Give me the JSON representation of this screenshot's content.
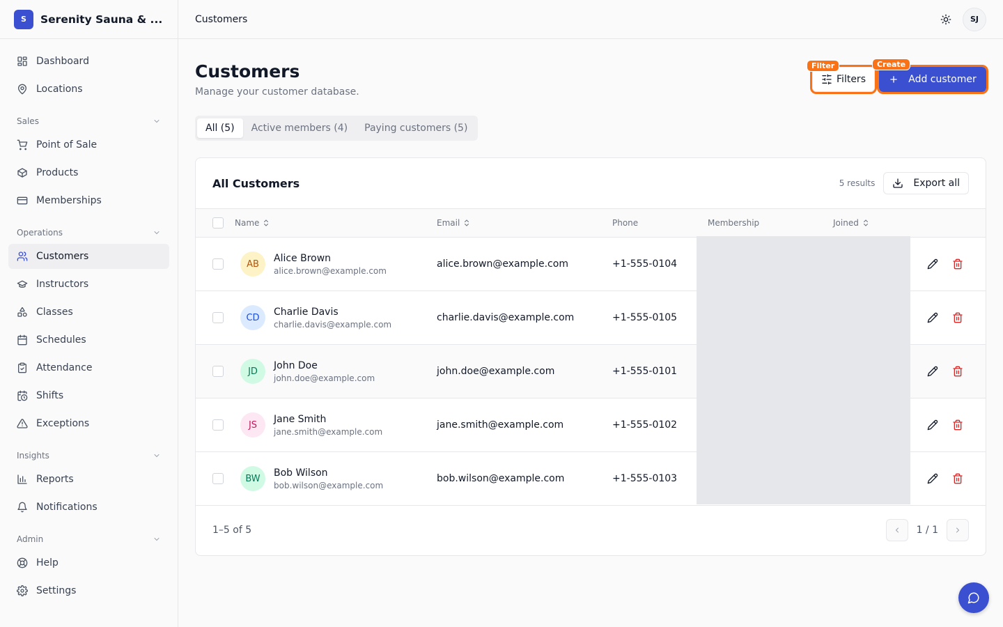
{
  "brand": {
    "initial": "S",
    "name": "Serenity Sauna & ..."
  },
  "sidebar": {
    "top_items": [
      {
        "label": "Dashboard",
        "icon": "dashboard-icon"
      },
      {
        "label": "Locations",
        "icon": "map-pin-icon"
      }
    ],
    "groups": [
      {
        "title": "Sales",
        "items": [
          {
            "label": "Point of Sale",
            "icon": "cart-icon"
          },
          {
            "label": "Products",
            "icon": "package-icon"
          },
          {
            "label": "Memberships",
            "icon": "credit-card-icon"
          }
        ]
      },
      {
        "title": "Operations",
        "items": [
          {
            "label": "Customers",
            "icon": "users-icon",
            "active": true
          },
          {
            "label": "Instructors",
            "icon": "graduation-cap-icon"
          },
          {
            "label": "Classes",
            "icon": "shapes-icon"
          },
          {
            "label": "Schedules",
            "icon": "calendar-icon"
          },
          {
            "label": "Attendance",
            "icon": "clipboard-check-icon"
          },
          {
            "label": "Shifts",
            "icon": "calendar-clock-icon"
          },
          {
            "label": "Exceptions",
            "icon": "alert-triangle-icon"
          }
        ]
      },
      {
        "title": "Insights",
        "items": [
          {
            "label": "Reports",
            "icon": "bar-chart-icon"
          },
          {
            "label": "Notifications",
            "icon": "bell-icon"
          }
        ]
      },
      {
        "title": "Admin",
        "items": [
          {
            "label": "Help",
            "icon": "life-buoy-icon"
          },
          {
            "label": "Settings",
            "icon": "gear-icon"
          }
        ]
      }
    ]
  },
  "topbar": {
    "breadcrumb": "Customers",
    "user_initials": "SJ"
  },
  "page": {
    "title": "Customers",
    "subtitle": "Manage your customer database.",
    "filters_label": "Filters",
    "add_label": "Add customer",
    "tag_filter": "Filter",
    "tag_create": "Create"
  },
  "tabs": [
    {
      "label": "All (5)",
      "active": true
    },
    {
      "label": "Active members (4)"
    },
    {
      "label": "Paying customers (5)"
    }
  ],
  "table": {
    "title": "All Customers",
    "result_count": "5 results",
    "export_label": "Export all",
    "columns": {
      "name": "Name",
      "email": "Email",
      "phone": "Phone",
      "membership": "Membership",
      "joined": "Joined"
    },
    "rows": [
      {
        "initials": "AB",
        "name": "Alice Brown",
        "sub_email": "alice.brown@example.com",
        "email": "alice.brown@example.com",
        "phone": "+1-555-0104",
        "avatar_bg": "#fef3c7",
        "avatar_fg": "#b45309"
      },
      {
        "initials": "CD",
        "name": "Charlie Davis",
        "sub_email": "charlie.davis@example.com",
        "email": "charlie.davis@example.com",
        "phone": "+1-555-0105",
        "avatar_bg": "#dbeafe",
        "avatar_fg": "#1d4ed8"
      },
      {
        "initials": "JD",
        "name": "John Doe",
        "sub_email": "john.doe@example.com",
        "email": "john.doe@example.com",
        "phone": "+1-555-0101",
        "avatar_bg": "#d1fae5",
        "avatar_fg": "#047857"
      },
      {
        "initials": "JS",
        "name": "Jane Smith",
        "sub_email": "jane.smith@example.com",
        "email": "jane.smith@example.com",
        "phone": "+1-555-0102",
        "avatar_bg": "#fce7f3",
        "avatar_fg": "#be185d"
      },
      {
        "initials": "BW",
        "name": "Bob Wilson",
        "sub_email": "bob.wilson@example.com",
        "email": "bob.wilson@example.com",
        "phone": "+1-555-0103",
        "avatar_bg": "#d1fae5",
        "avatar_fg": "#047857"
      }
    ],
    "footer_range": "1–5 of 5",
    "page_label": "1 / 1"
  },
  "colors": {
    "accent": "#3b4fd1",
    "highlight": "#f97316",
    "danger": "#dc2626"
  }
}
